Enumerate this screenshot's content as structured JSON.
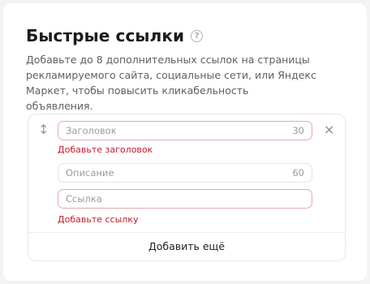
{
  "section": {
    "title": "Быстрые ссылки",
    "help_icon": "?",
    "description": "Добавьте до 8 дополнительных ссылок на страницы рекламируемого сайта, социальные сети, или Яндекс Маркет, чтобы повысить кликабельность объявления."
  },
  "link_form": {
    "drag_icon": "↕",
    "close_icon": "×",
    "title_field": {
      "placeholder": "Заголовок",
      "counter": "30",
      "error": "Добавьте заголовок"
    },
    "description_field": {
      "placeholder": "Описание",
      "counter": "60"
    },
    "url_field": {
      "placeholder": "Ссылка",
      "error": "Добавьте ссылку"
    }
  },
  "add_more_label": "Добавить ещё",
  "colors": {
    "error": "#c3192a",
    "error_border": "#e5a9ae"
  }
}
